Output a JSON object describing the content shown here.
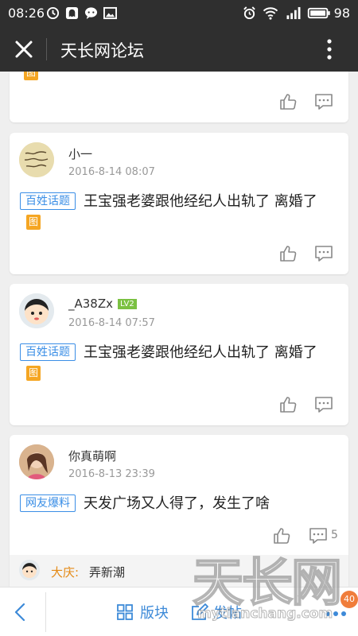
{
  "status_bar": {
    "time": "08:26",
    "battery": "98"
  },
  "header": {
    "title": "天长网论坛"
  },
  "posts": [
    {
      "author": "",
      "date": "",
      "tag": "",
      "text": "",
      "pic_label": "图",
      "comment_count": ""
    },
    {
      "author": "小一",
      "date": "2016-8-14 08:07",
      "tag": "百姓话题",
      "text": "王宝强老婆跟他经纪人出轨了 离婚了",
      "pic_label": "图",
      "comment_count": ""
    },
    {
      "author": "_A38Zx",
      "level": "LV2",
      "date": "2016-8-14 07:57",
      "tag": "百姓话题",
      "text": "王宝强老婆跟他经纪人出轨了 离婚了",
      "pic_label": "图",
      "comment_count": ""
    },
    {
      "author": "你真萌啊",
      "date": "2016-8-13 23:39",
      "tag": "网友爆料",
      "text": "天发广场又人得了，发生了啥",
      "comment_count": "5"
    }
  ],
  "reply_preview": {
    "name": "大庆:",
    "text": "弄新潮"
  },
  "bottom_bar": {
    "sections_label": "版块",
    "post_label": "发帖",
    "badge": "40"
  },
  "watermark": {
    "logo": "天长网",
    "url": "mytianchang.com"
  },
  "colors": {
    "dark_bar": "#2f2f2f",
    "accent_blue": "#3a8ee6",
    "pic_orange": "#f5a623",
    "badge_orange": "#f07d3b",
    "level_green": "#7bc142"
  }
}
